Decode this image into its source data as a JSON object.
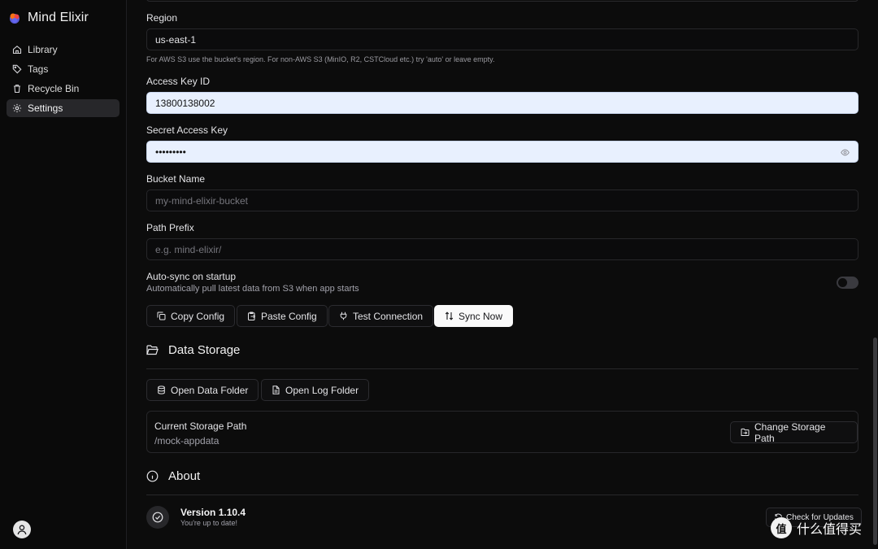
{
  "app": {
    "name": "Mind Elixir"
  },
  "sidebar": {
    "items": [
      {
        "label": "Library",
        "icon": "home-icon"
      },
      {
        "label": "Tags",
        "icon": "tag-icon"
      },
      {
        "label": "Recycle Bin",
        "icon": "trash-icon"
      },
      {
        "label": "Settings",
        "icon": "gear-icon",
        "active": true
      }
    ]
  },
  "s3": {
    "region_label": "Region",
    "region_value": "us-east-1",
    "region_hint": "For AWS S3 use the bucket's region. For non-AWS S3 (MinIO, R2, CSTCloud etc.) try 'auto' or leave empty.",
    "access_key_label": "Access Key ID",
    "access_key_value": "13800138002",
    "secret_key_label": "Secret Access Key",
    "secret_key_value": "•••••••••",
    "bucket_label": "Bucket Name",
    "bucket_placeholder": "my-mind-elixir-bucket",
    "prefix_label": "Path Prefix",
    "prefix_placeholder": "e.g. mind-elixir/",
    "autosync_title": "Auto-sync on startup",
    "autosync_desc": "Automatically pull latest data from S3 when app starts",
    "autosync_enabled": false,
    "buttons": {
      "copy": "Copy Config",
      "paste": "Paste Config",
      "test": "Test Connection",
      "sync": "Sync Now"
    }
  },
  "storage": {
    "title": "Data Storage",
    "open_data": "Open Data Folder",
    "open_log": "Open Log Folder",
    "path_title": "Current Storage Path",
    "path_value": "/mock-appdata",
    "change_path": "Change Storage Path"
  },
  "about": {
    "title": "About",
    "version": "Version 1.10.4",
    "status": "You're up to date!",
    "check": "Check for Updates"
  },
  "watermark": {
    "badge": "值",
    "text": "什么值得买"
  },
  "colors": {
    "accent_input": "#e8f0fe",
    "background": "#0c0c0c",
    "primary_button": "#fafafa"
  }
}
